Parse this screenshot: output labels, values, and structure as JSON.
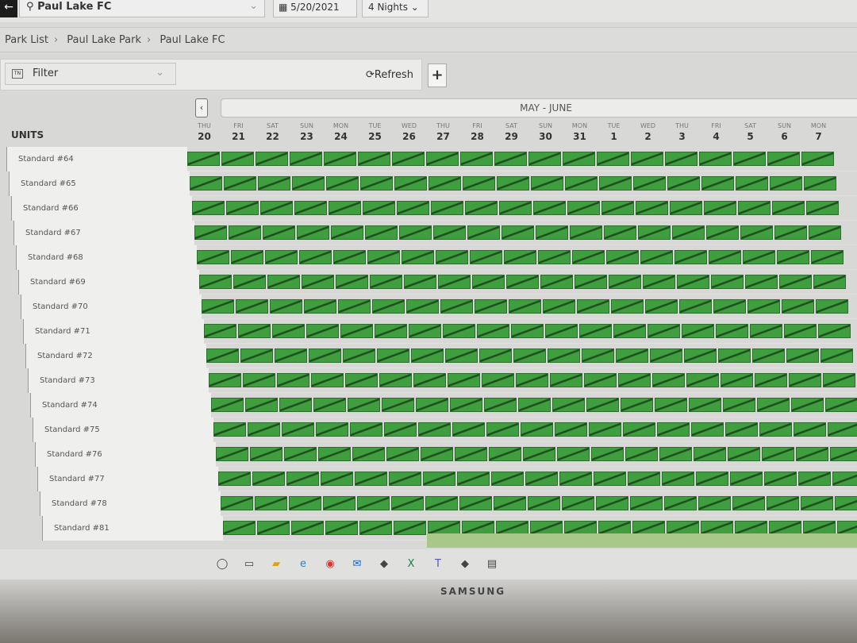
{
  "topbar": {
    "location": "Paul Lake FC",
    "date": "5/20/2021",
    "nights": "4 Nights"
  },
  "breadcrumb": [
    "Park List",
    "Paul Lake Park",
    "Paul Lake FC"
  ],
  "toolbar": {
    "filter_label": "Filter",
    "refresh_label": "Refresh",
    "add_label": "+"
  },
  "calendar": {
    "month_label": "MAY - JUNE",
    "units_header": "UNITS",
    "days": [
      {
        "w": "THU",
        "n": "20"
      },
      {
        "w": "FRI",
        "n": "21"
      },
      {
        "w": "SAT",
        "n": "22"
      },
      {
        "w": "SUN",
        "n": "23"
      },
      {
        "w": "MON",
        "n": "24"
      },
      {
        "w": "TUE",
        "n": "25"
      },
      {
        "w": "WED",
        "n": "26"
      },
      {
        "w": "THU",
        "n": "27"
      },
      {
        "w": "FRI",
        "n": "28"
      },
      {
        "w": "SAT",
        "n": "29"
      },
      {
        "w": "SUN",
        "n": "30"
      },
      {
        "w": "MON",
        "n": "31"
      },
      {
        "w": "TUE",
        "n": "1"
      },
      {
        "w": "WED",
        "n": "2"
      },
      {
        "w": "THU",
        "n": "3"
      },
      {
        "w": "FRI",
        "n": "4"
      },
      {
        "w": "SAT",
        "n": "5"
      },
      {
        "w": "SUN",
        "n": "6"
      },
      {
        "w": "MON",
        "n": "7"
      }
    ],
    "units": [
      "Standard #64",
      "Standard #65",
      "Standard #66",
      "Standard #67",
      "Standard #68",
      "Standard #69",
      "Standard #70",
      "Standard #71",
      "Standard #72",
      "Standard #73",
      "Standard #74",
      "Standard #75",
      "Standard #76",
      "Standard #77",
      "Standard #78",
      "Standard #81"
    ],
    "cell_status": "reserved",
    "cell_color": "#3f9f3f"
  },
  "taskbar": [
    "search-icon",
    "task-view-icon",
    "file-explorer-icon",
    "edge-icon",
    "chrome-icon",
    "outlook-icon",
    "app-icon",
    "excel-icon",
    "teams-icon",
    "app-icon",
    "notepad-icon"
  ],
  "monitor": {
    "brand": "SAMSUNG"
  }
}
